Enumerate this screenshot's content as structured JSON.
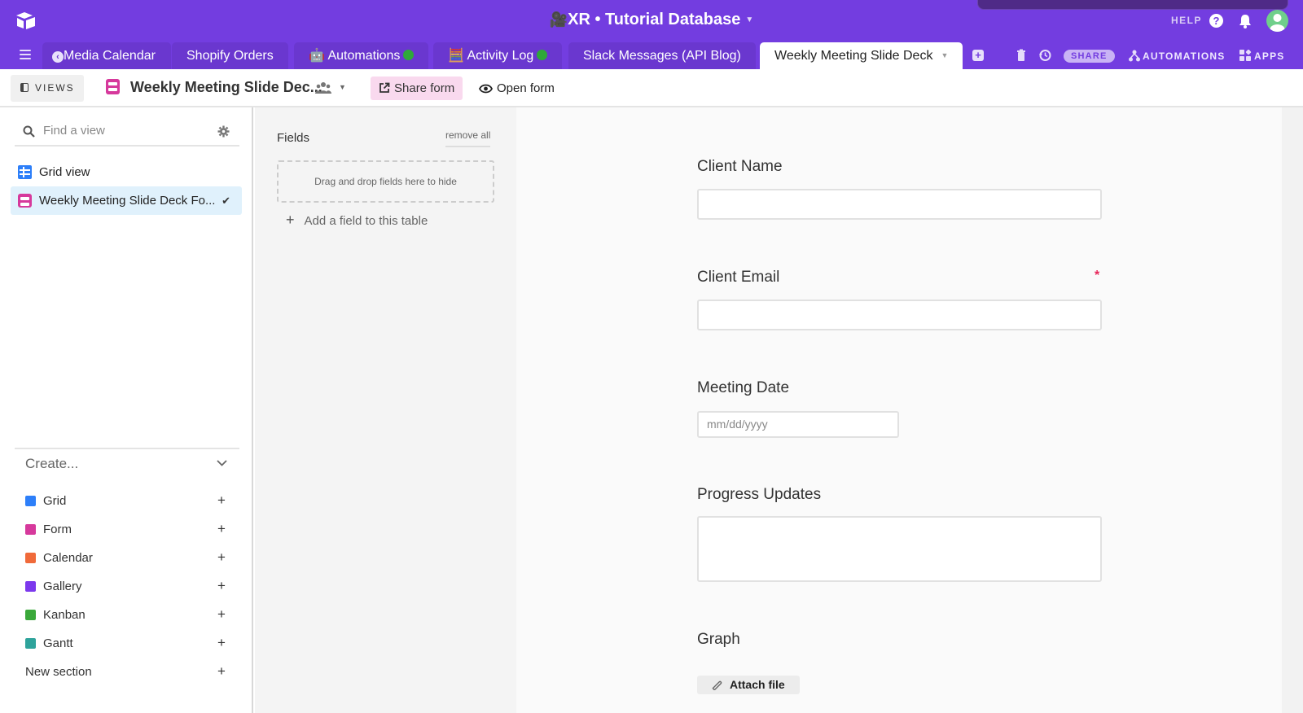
{
  "header": {
    "base_emoji": "🎥",
    "base_title": "XR • Tutorial Database",
    "help_label": "HELP",
    "colors": {
      "brand": "#733de0",
      "tab_bg": "#6a37cf",
      "avatar": "#6fcf8b",
      "form_pink": "#d6399c",
      "required": "#e8265a"
    }
  },
  "tabs": [
    {
      "label": "Media Calendar",
      "has_back": true
    },
    {
      "label": "Shopify Orders"
    },
    {
      "label": "🤖 Automations",
      "status_dot": true
    },
    {
      "label": "🧮 Activity Log",
      "status_dot": true
    },
    {
      "label": "Slack Messages (API Blog)"
    },
    {
      "label": "Weekly Meeting Slide Deck",
      "active": true
    }
  ],
  "toolbar": {
    "share_label": "SHARE",
    "automations_label": "AUTOMATIONS",
    "apps_label": "APPS"
  },
  "viewbar": {
    "views_label": "VIEWS",
    "view_name": "Weekly Meeting Slide Dec...",
    "share_form_label": "Share form",
    "open_form_label": "Open form"
  },
  "sidebar": {
    "search_placeholder": "Find a view",
    "views": [
      {
        "label": "Grid view",
        "type": "grid"
      },
      {
        "label": "Weekly Meeting Slide Deck Fo...",
        "type": "form",
        "selected": true
      }
    ],
    "create_label": "Create...",
    "create_items": [
      {
        "label": "Grid",
        "color": "#2d7ff9"
      },
      {
        "label": "Form",
        "color": "#d6399c"
      },
      {
        "label": "Calendar",
        "color": "#f06a3a"
      },
      {
        "label": "Gallery",
        "color": "#7c39ed"
      },
      {
        "label": "Kanban",
        "color": "#3aa83a"
      },
      {
        "label": "Gantt",
        "color": "#2ea39b"
      },
      {
        "label": "New section"
      }
    ]
  },
  "fields_panel": {
    "title": "Fields",
    "remove_all": "remove all",
    "dropzone_text": "Drag and drop fields here to hide",
    "add_field": "Add a field to this table"
  },
  "form": {
    "fields": [
      {
        "label": "Client Name",
        "value": ""
      },
      {
        "label": "Client Email",
        "value": "",
        "required": true,
        "required_mark": "*"
      },
      {
        "label": "Meeting Date",
        "placeholder": "mm/dd/yyyy"
      },
      {
        "label": "Progress Updates",
        "value": ""
      },
      {
        "label": "Graph",
        "button": "Attach file"
      }
    ]
  }
}
